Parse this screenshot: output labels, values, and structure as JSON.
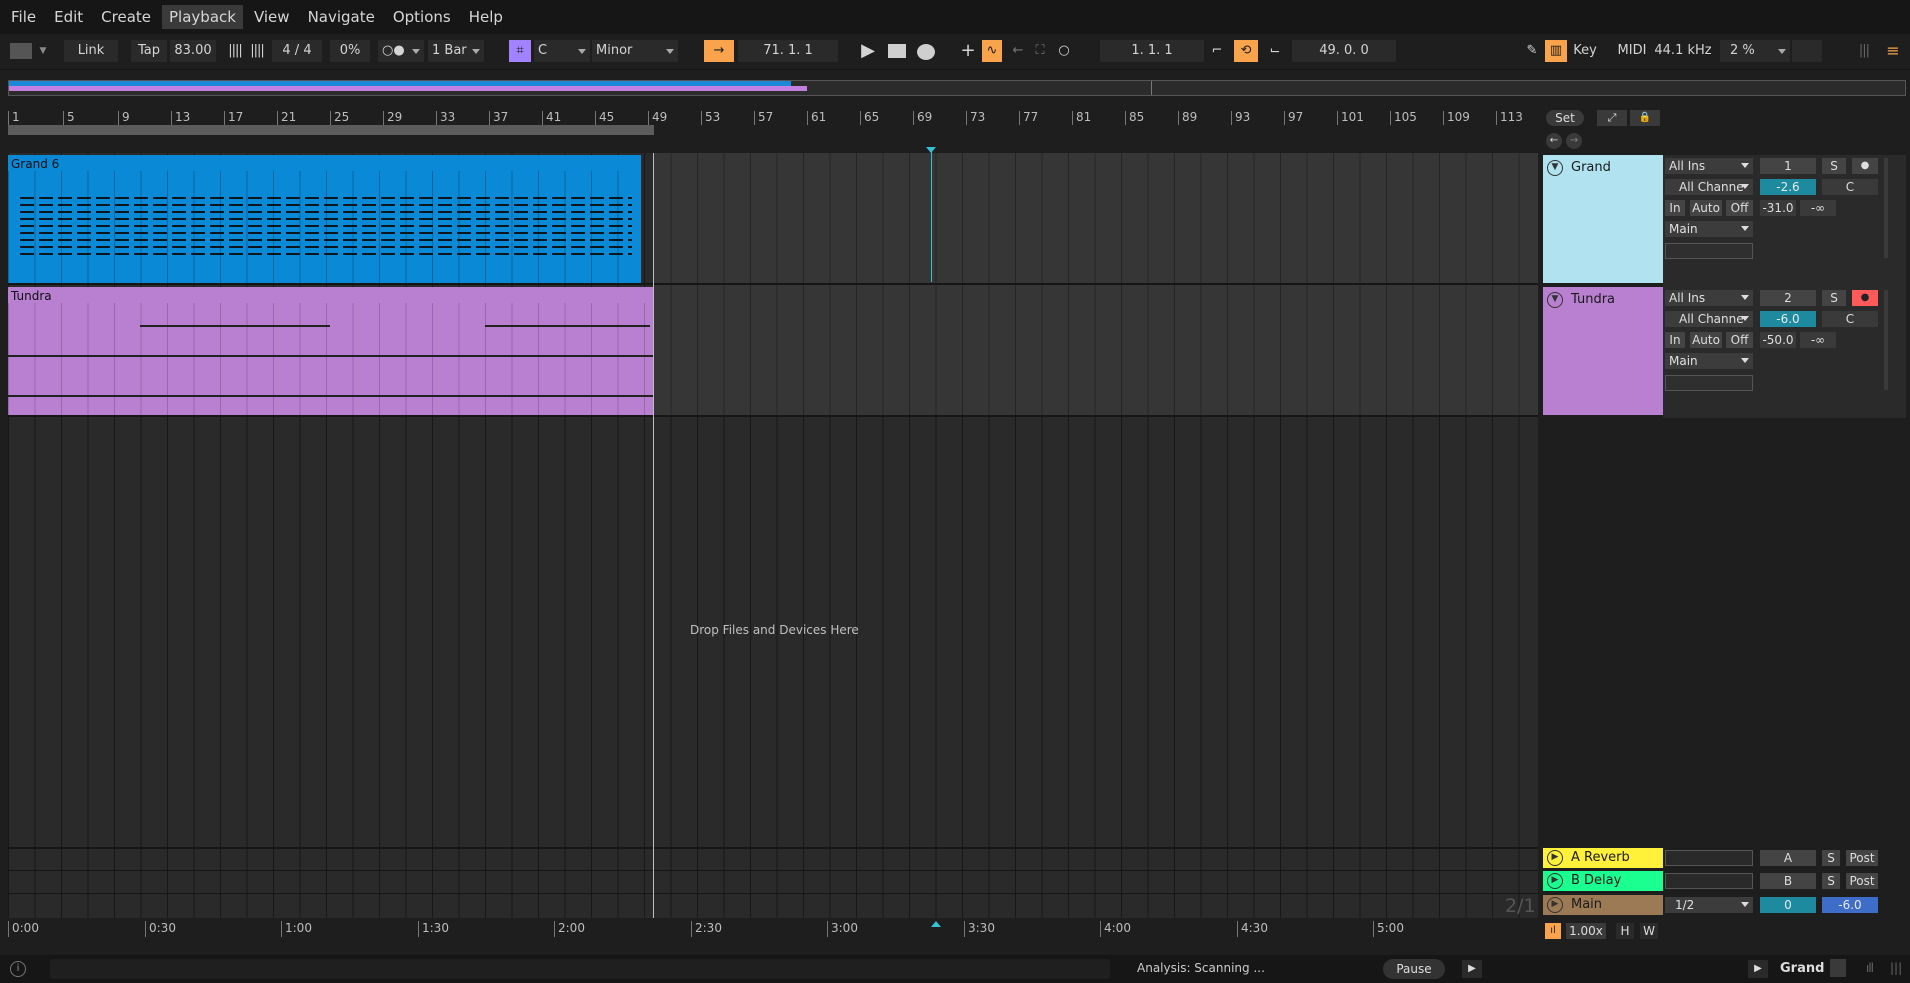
{
  "menu": [
    "File",
    "Edit",
    "Create",
    "Playback",
    "View",
    "Navigate",
    "Options",
    "Help"
  ],
  "toolbar": {
    "link": "Link",
    "tap": "Tap",
    "tempo": "83.00",
    "signature": "4 / 4",
    "groove": "0%",
    "quantize": "1 Bar",
    "key": "C",
    "scale": "Minor",
    "position": "71.  1.  1",
    "loop_start": "1.  1.  1",
    "loop_length": "49.  0.  0",
    "key_label": "Key",
    "midi_label": "MIDI",
    "sample_rate": "44.1 kHz",
    "cpu": "2 %"
  },
  "ruler": [
    "1",
    "5",
    "9",
    "13",
    "17",
    "21",
    "25",
    "29",
    "33",
    "37",
    "41",
    "45",
    "49",
    "53",
    "57",
    "61",
    "65",
    "69",
    "73",
    "77",
    "81",
    "85",
    "89",
    "93",
    "97",
    "101",
    "105",
    "109",
    "113"
  ],
  "timeline": [
    "0:00",
    "0:30",
    "1:00",
    "1:30",
    "2:00",
    "2:30",
    "3:00",
    "3:30",
    "4:00",
    "4:30",
    "5:00"
  ],
  "arrangement": {
    "drop_hint": "Drop Files and Devices Here",
    "clips": [
      {
        "name": "Grand 6",
        "color": "#0a89d6"
      },
      {
        "name": "Tundra",
        "color": "#b97fd1"
      }
    ]
  },
  "set_button": "Set",
  "tracks": [
    {
      "name": "Grand",
      "color": "#b0e2f0",
      "input": "All Ins",
      "channel": "All Channe",
      "monitor": [
        "In",
        "Auto",
        "Off"
      ],
      "output": "Main",
      "number": "1",
      "solo": "S",
      "volume": "-2.6",
      "pan": "C",
      "send": "-31.0",
      "peak": "-∞"
    },
    {
      "name": "Tundra",
      "color": "#b97fd1",
      "input": "All Ins",
      "channel": "All Channe",
      "monitor": [
        "In",
        "Auto",
        "Off"
      ],
      "output": "Main",
      "number": "2",
      "solo": "S",
      "volume": "-6.0",
      "pan": "C",
      "send": "-50.0",
      "peak": "-∞"
    }
  ],
  "returns": [
    {
      "name": "A Reverb",
      "color": "#fff03a",
      "letter": "A",
      "solo": "S",
      "post": "Post"
    },
    {
      "name": "B Delay",
      "color": "#1aff8f",
      "letter": "B",
      "solo": "S",
      "post": "Post"
    }
  ],
  "main_track": {
    "name": "Main",
    "color": "#9c7a55",
    "cue": "1/2",
    "volume": "0",
    "pan": "-6.0",
    "page": "2/1"
  },
  "bottom": {
    "zoom": "1.00x",
    "h": "H",
    "w": "W"
  },
  "status": {
    "analysis": "Analysis: Scanning ...",
    "pause": "Pause",
    "track": "Grand"
  }
}
